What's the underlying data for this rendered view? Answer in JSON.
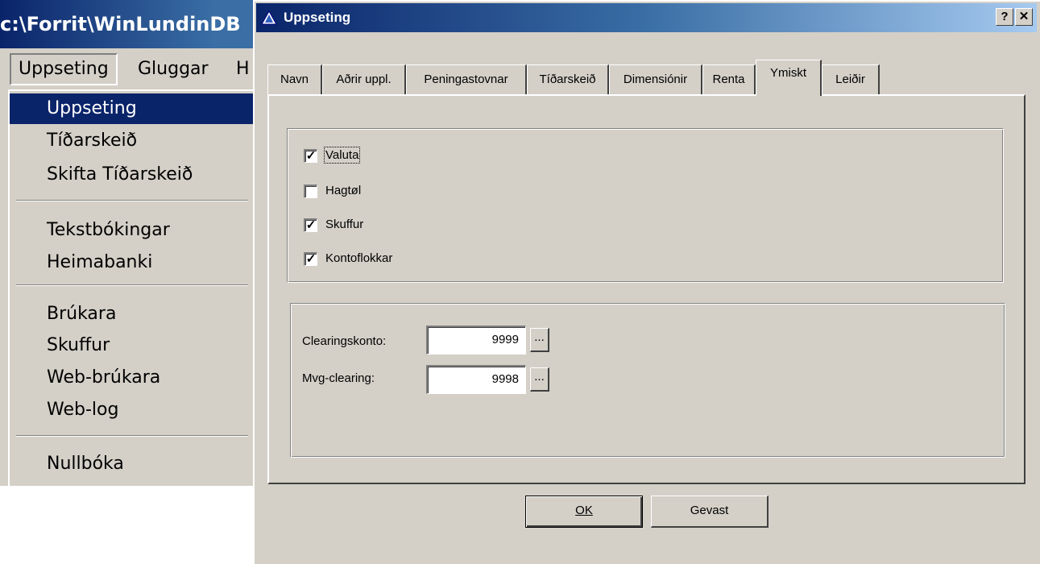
{
  "main_window": {
    "title": "c:\\Forrit\\WinLundinDB",
    "menubar": [
      "Uppseting",
      "Gluggar",
      "H"
    ],
    "dropdown": {
      "groups": [
        [
          "Uppseting",
          "Tíðarskeið",
          "Skifta Tíðarskeið"
        ],
        [
          "Tekstbókingar",
          "Heimabanki"
        ],
        [
          "Brúkara",
          "Skuffur",
          "Web-brúkara",
          "Web-log"
        ],
        [
          "Nullbóka"
        ]
      ],
      "selected": "Uppseting"
    }
  },
  "dialog": {
    "title": "Uppseting",
    "help_label": "?",
    "close_label": "✕",
    "tabs": [
      "Navn",
      "Aðrir uppl.",
      "Peningastovnar",
      "Tíðarskeið",
      "Dimensiónir",
      "Renta",
      "Ymiskt",
      "Leiðir"
    ],
    "active_tab": "Ymiskt",
    "checkboxes": [
      {
        "label": "Valuta",
        "checked": true
      },
      {
        "label": "Hagtøl",
        "checked": false
      },
      {
        "label": "Skuffur",
        "checked": true
      },
      {
        "label": "Kontoflokkar",
        "checked": true
      }
    ],
    "fields": [
      {
        "label": "Clearingskonto:",
        "value": "9999",
        "button": "..."
      },
      {
        "label": "Mvg-clearing:",
        "value": "9998",
        "button": "..."
      }
    ],
    "ok_label": "OK",
    "cancel_label": "Gevast"
  }
}
